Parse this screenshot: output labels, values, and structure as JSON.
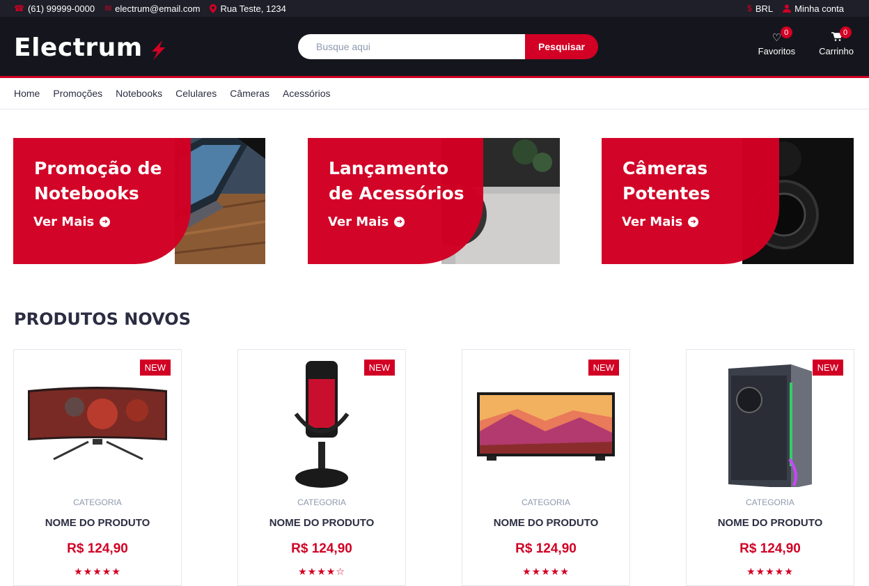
{
  "topbar": {
    "phone": "(61) 99999-0000",
    "email": "electrum@email.com",
    "address": "Rua Teste, 1234",
    "currency": "BRL",
    "account": "Minha conta"
  },
  "header": {
    "logo": "Electrum",
    "search_placeholder": "Busque aqui",
    "search_button": "Pesquisar",
    "favorites_label": "Favoritos",
    "favorites_count": "0",
    "cart_label": "Carrinho",
    "cart_count": "0"
  },
  "nav": {
    "items": [
      "Home",
      "Promoções",
      "Notebooks",
      "Celulares",
      "Câmeras",
      "Acessórios"
    ]
  },
  "banners": [
    {
      "line1": "Promoção de",
      "line2": "Notebooks",
      "cta": "Ver Mais"
    },
    {
      "line1": "Lançamento",
      "line2": "de Acessórios",
      "cta": "Ver Mais"
    },
    {
      "line1": "Câmeras",
      "line2": "Potentes",
      "cta": "Ver Mais"
    }
  ],
  "section": {
    "title": "PRODUTOS NOVOS"
  },
  "products": [
    {
      "badge": "NEW",
      "category": "CATEGORIA",
      "name": "NOME DO PRODUTO",
      "price": "R$ 124,90",
      "rating": 5,
      "image": "monitor-image"
    },
    {
      "badge": "NEW",
      "category": "CATEGORIA",
      "name": "NOME DO PRODUTO",
      "price": "R$ 124,90",
      "rating": 4,
      "image": "microphone-image"
    },
    {
      "badge": "NEW",
      "category": "CATEGORIA",
      "name": "NOME DO PRODUTO",
      "price": "R$ 124,90",
      "rating": 5,
      "image": "tv-image"
    },
    {
      "badge": "NEW",
      "category": "CATEGORIA",
      "name": "NOME DO PRODUTO",
      "price": "R$ 124,90",
      "rating": 5,
      "image": "pc-case-image"
    }
  ],
  "colors": {
    "accent": "#D10024",
    "dark": "#15161d",
    "topbar": "#1e1f29"
  }
}
